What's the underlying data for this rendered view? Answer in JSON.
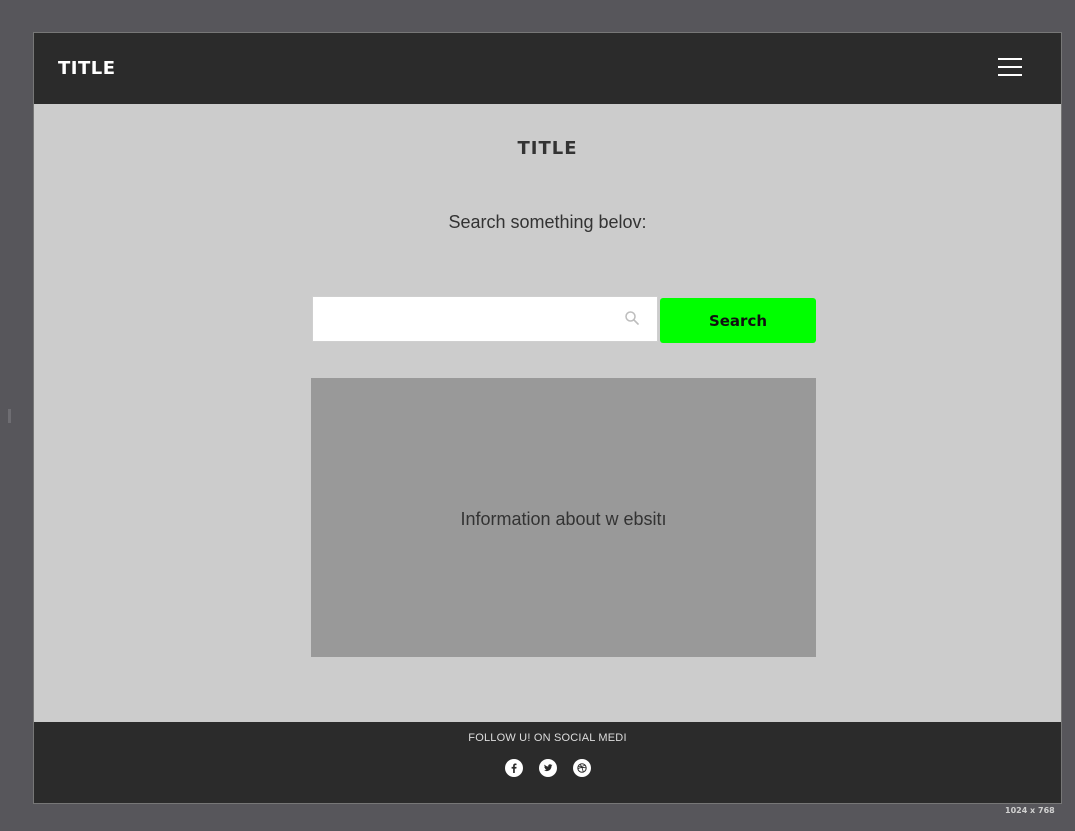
{
  "header": {
    "title": "TITLE",
    "menu_icon": "hamburger-menu-icon"
  },
  "main": {
    "title": "TITLE",
    "subtitle": "Search something belov:",
    "search": {
      "value": "",
      "placeholder": "",
      "icon": "search-icon",
      "button_label": "Search"
    },
    "info_text": "Information about w ebsitı"
  },
  "footer": {
    "text": "FOLLOW U! ON SOCIAL MEDI",
    "social_icons": [
      "facebook-icon",
      "twitter-icon",
      "dribbble-icon"
    ]
  },
  "canvas_size_label": "1024 x 768",
  "colors": {
    "outer_background": "#57565b",
    "header_background": "#2b2b2b",
    "page_background": "#cccccc",
    "info_box_background": "#999999",
    "search_button": "#00ff00",
    "text": "#333333"
  }
}
